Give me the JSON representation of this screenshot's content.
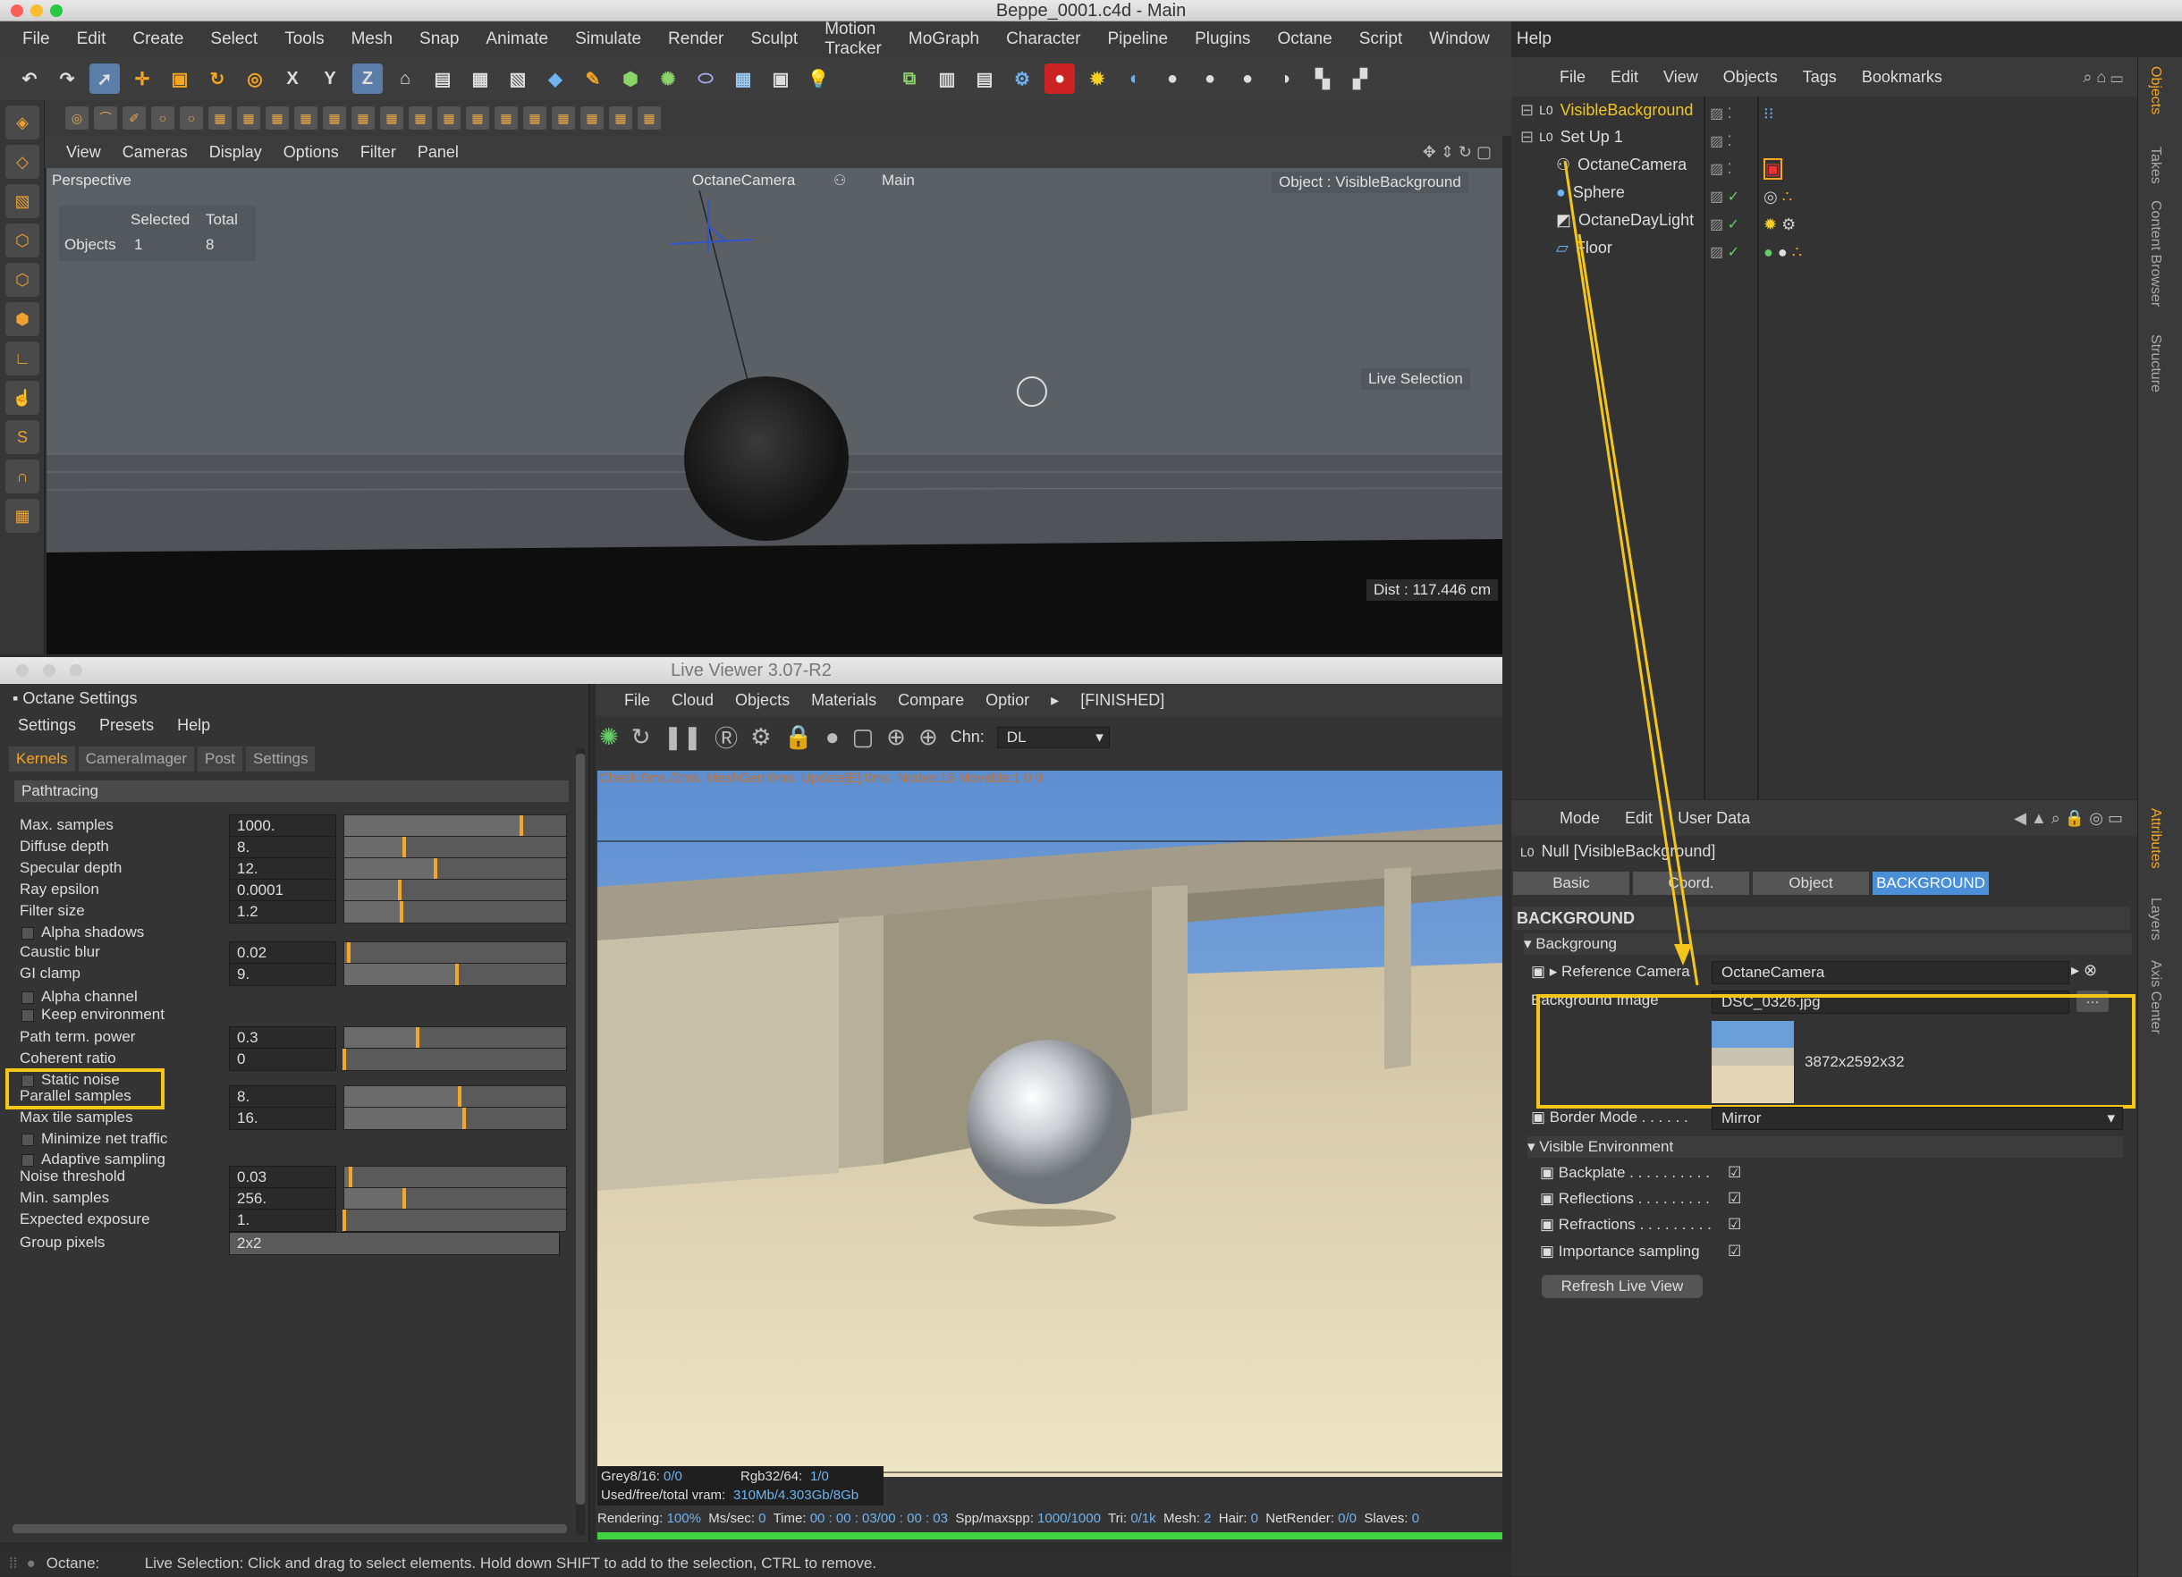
{
  "window": {
    "title": "Beppe_0001.c4d - Main"
  },
  "menu": [
    "File",
    "Edit",
    "Create",
    "Select",
    "Tools",
    "Mesh",
    "Snap",
    "Animate",
    "Simulate",
    "Render",
    "Sculpt",
    "Motion Tracker",
    "MoGraph",
    "Character",
    "Pipeline",
    "Plugins",
    "Octane",
    "Script",
    "Window",
    "Help"
  ],
  "viewport": {
    "menu": [
      "View",
      "Cameras",
      "Display",
      "Options",
      "Filter",
      "Panel"
    ],
    "label": "Perspective",
    "camera_label": "OctaneCamera",
    "main_label": "Main",
    "object_label": "Object : VisibleBackground",
    "stats_header_selected": "Selected",
    "stats_header_total": "Total",
    "stats_row_label": "Objects",
    "stats_selected": "1",
    "stats_total": "8",
    "live_selection": "Live Selection",
    "dist": "Dist : 117.446 cm"
  },
  "objects": {
    "menu": [
      "File",
      "Edit",
      "View",
      "Objects",
      "Tags",
      "Bookmarks"
    ],
    "items": [
      {
        "name": "VisibleBackground"
      },
      {
        "name": "Set Up 1"
      },
      {
        "name": "OctaneCamera"
      },
      {
        "name": "Sphere"
      },
      {
        "name": "OctaneDayLight"
      },
      {
        "name": "Floor"
      }
    ]
  },
  "side_tabs": [
    "Objects",
    "Takes",
    "Content Browser",
    "Structure",
    "Attributes",
    "Layers",
    "Axis Center"
  ],
  "attributes": {
    "menu": [
      "Mode",
      "Edit",
      "User Data"
    ],
    "null_label": "Null [VisibleBackground]",
    "tabs": [
      "Basic",
      "Coord.",
      "Object",
      "BACKGROUND"
    ],
    "section": "BACKGROUND",
    "group_background": "Backgroung",
    "reference_camera_label": "Reference Camera",
    "reference_camera_value": "OctaneCamera",
    "background_image_label": "Background Image",
    "background_image_value": "DSC_0326.jpg",
    "image_dims": "3872x2592x32",
    "border_mode_label": "Border Mode . . . . . .",
    "border_mode_value": "Mirror",
    "group_visible_env": "Visible Environment",
    "checks": [
      {
        "label": "Backplate . . . . . . . . . .",
        "checked": true
      },
      {
        "label": "Reflections . . . . . . . . .",
        "checked": true
      },
      {
        "label": "Refractions . . . . . . . . .",
        "checked": true
      },
      {
        "label": "Importance sampling",
        "checked": true
      }
    ],
    "refresh_button": "Refresh Live View"
  },
  "live_viewer": {
    "title": "Live Viewer 3.07-R2",
    "menu": [
      "File",
      "Cloud",
      "Objects",
      "Materials",
      "Compare",
      "Optior"
    ],
    "finished": "[FINISHED]",
    "chn_label": "Chn:",
    "chn_value": "DL",
    "debug_line": "Check:0ms./2ms. MeshGen:0ms. Update[E]:0ms. Nodes:15 Movable:1  0 0",
    "grey_label": "Grey8/16:",
    "grey_value": "0/0",
    "rgb_label": "Rgb32/64:",
    "rgb_value": "1/0",
    "vram_label": "Used/free/total vram:",
    "vram_value": "310Mb/4.303Gb/8Gb",
    "status": {
      "rendering_label": "Rendering:",
      "rendering": "100%",
      "mssec_label": "Ms/sec:",
      "mssec": "0",
      "time_label": "Time:",
      "time": "00 : 00 : 03/00 : 00 : 03",
      "spp_label": "Spp/maxspp:",
      "spp": "1000/1000",
      "tri_label": "Tri:",
      "tri": "0/1k",
      "mesh_label": "Mesh:",
      "mesh": "2",
      "hair_label": "Hair:",
      "hair": "0",
      "netrender_label": "NetRender:",
      "netrender": "0/0",
      "slaves_label": "Slaves:",
      "slaves": "0"
    },
    "progress": 1.0
  },
  "octane_settings": {
    "title": "Octane Settings",
    "menu": [
      "Settings",
      "Presets",
      "Help"
    ],
    "tabs": [
      "Kernels",
      "CameraImager",
      "Post",
      "Settings"
    ],
    "kernel": "Pathtracing",
    "rows": [
      {
        "label": "Max. samples",
        "value": "1000.",
        "fill": 0.8
      },
      {
        "label": "Diffuse depth",
        "value": "8.",
        "fill": 0.27
      },
      {
        "label": "Specular depth",
        "value": "12.",
        "fill": 0.41
      },
      {
        "label": "Ray epsilon",
        "value": "0.0001",
        "fill": 0.25
      },
      {
        "label": "Filter size",
        "value": "1.2",
        "fill": 0.26
      },
      {
        "label": "Alpha shadows",
        "checkbox": true
      },
      {
        "label": "Caustic blur",
        "value": "0.02",
        "fill": 0.02
      },
      {
        "label": "GI clamp",
        "value": "9.",
        "fill": 0.51
      },
      {
        "label": "Alpha channel",
        "checkbox": true
      },
      {
        "label": "Keep environment",
        "checkbox": true
      },
      {
        "label": "Path term. power",
        "value": "0.3",
        "fill": 0.33
      },
      {
        "label": "Coherent ratio",
        "value": "0",
        "fill": 0.0
      },
      {
        "label": "Static noise",
        "checkbox": true
      },
      {
        "label": "Parallel samples",
        "value": "8.",
        "fill": 0.52
      },
      {
        "label": "Max tile samples",
        "value": "16.",
        "fill": 0.54
      },
      {
        "label": "Minimize net traffic",
        "checkbox": true
      },
      {
        "label": "Adaptive sampling",
        "checkbox": true
      },
      {
        "label": "Noise threshold",
        "value": "0.03",
        "fill": 0.03
      },
      {
        "label": "Min. samples",
        "value": "256.",
        "fill": 0.27
      },
      {
        "label": "Expected exposure",
        "value": "1.",
        "fill": 0.0
      },
      {
        "label": "Group pixels",
        "value": "2x2"
      }
    ]
  },
  "statusbar": {
    "app": "Octane:",
    "message": "Live Selection: Click and drag to select elements. Hold down SHIFT to add to the selection, CTRL to remove."
  },
  "colors": {
    "accent": "#f5a623",
    "highlight": "#f5c518",
    "selected_tab": "#4a8fd8"
  }
}
